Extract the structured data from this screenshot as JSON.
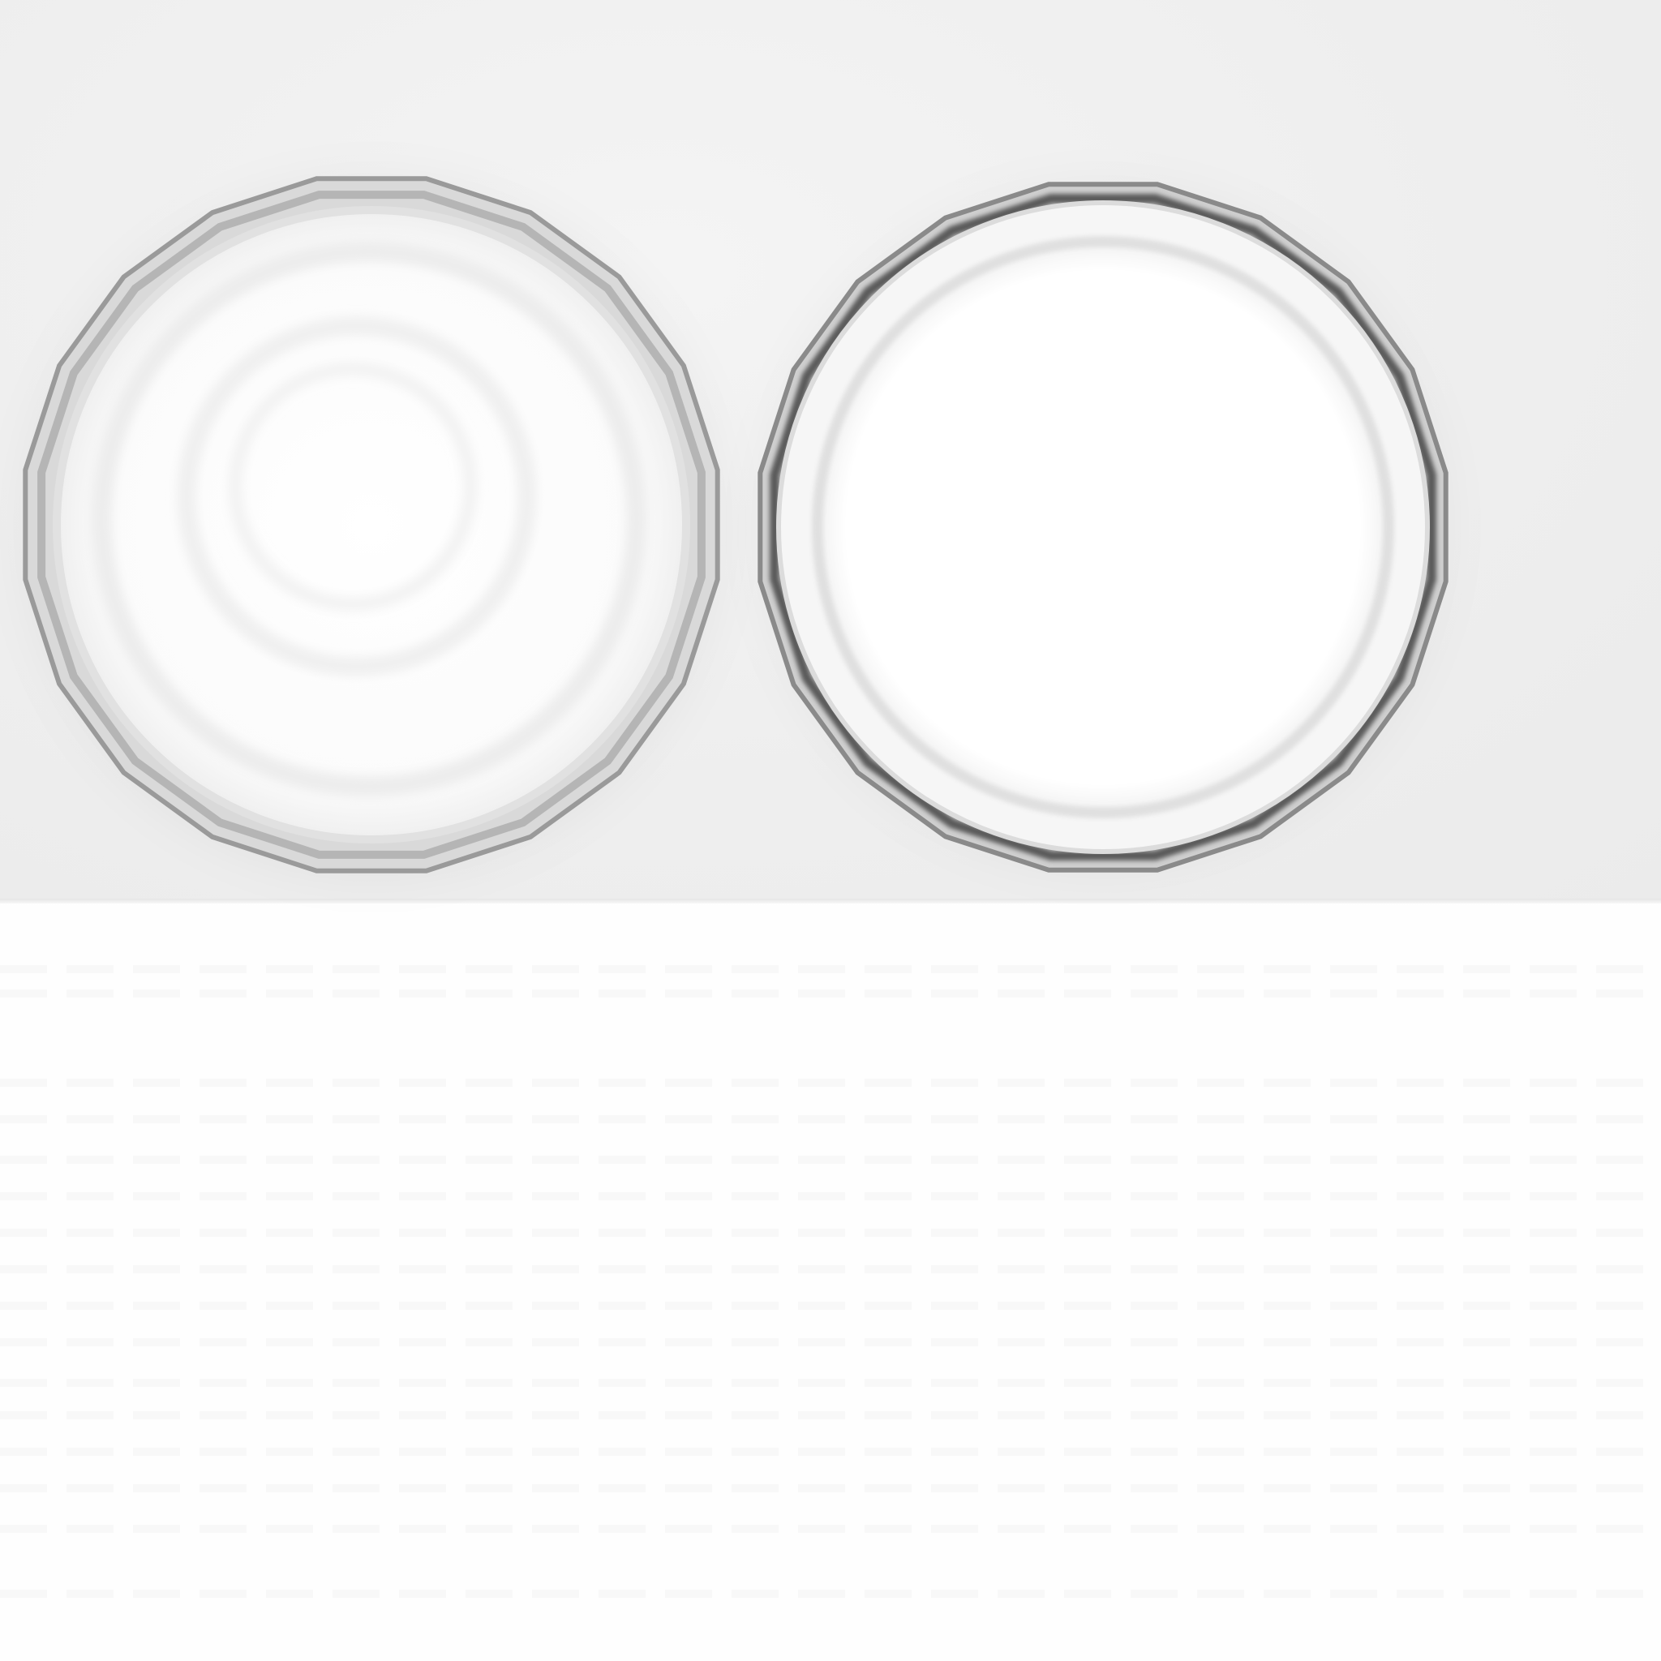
{
  "scene": {
    "description_colors": {
      "backdrop": "#eeeeee",
      "surface": "#fefefe",
      "lid_face": "#ffffff",
      "rim_dark": "#5a5a5a",
      "rim_light": "#bdbdbd"
    },
    "objects": [
      {
        "kind": "jar-lid",
        "view": "underside"
      },
      {
        "kind": "jar-lid",
        "view": "top"
      }
    ]
  }
}
